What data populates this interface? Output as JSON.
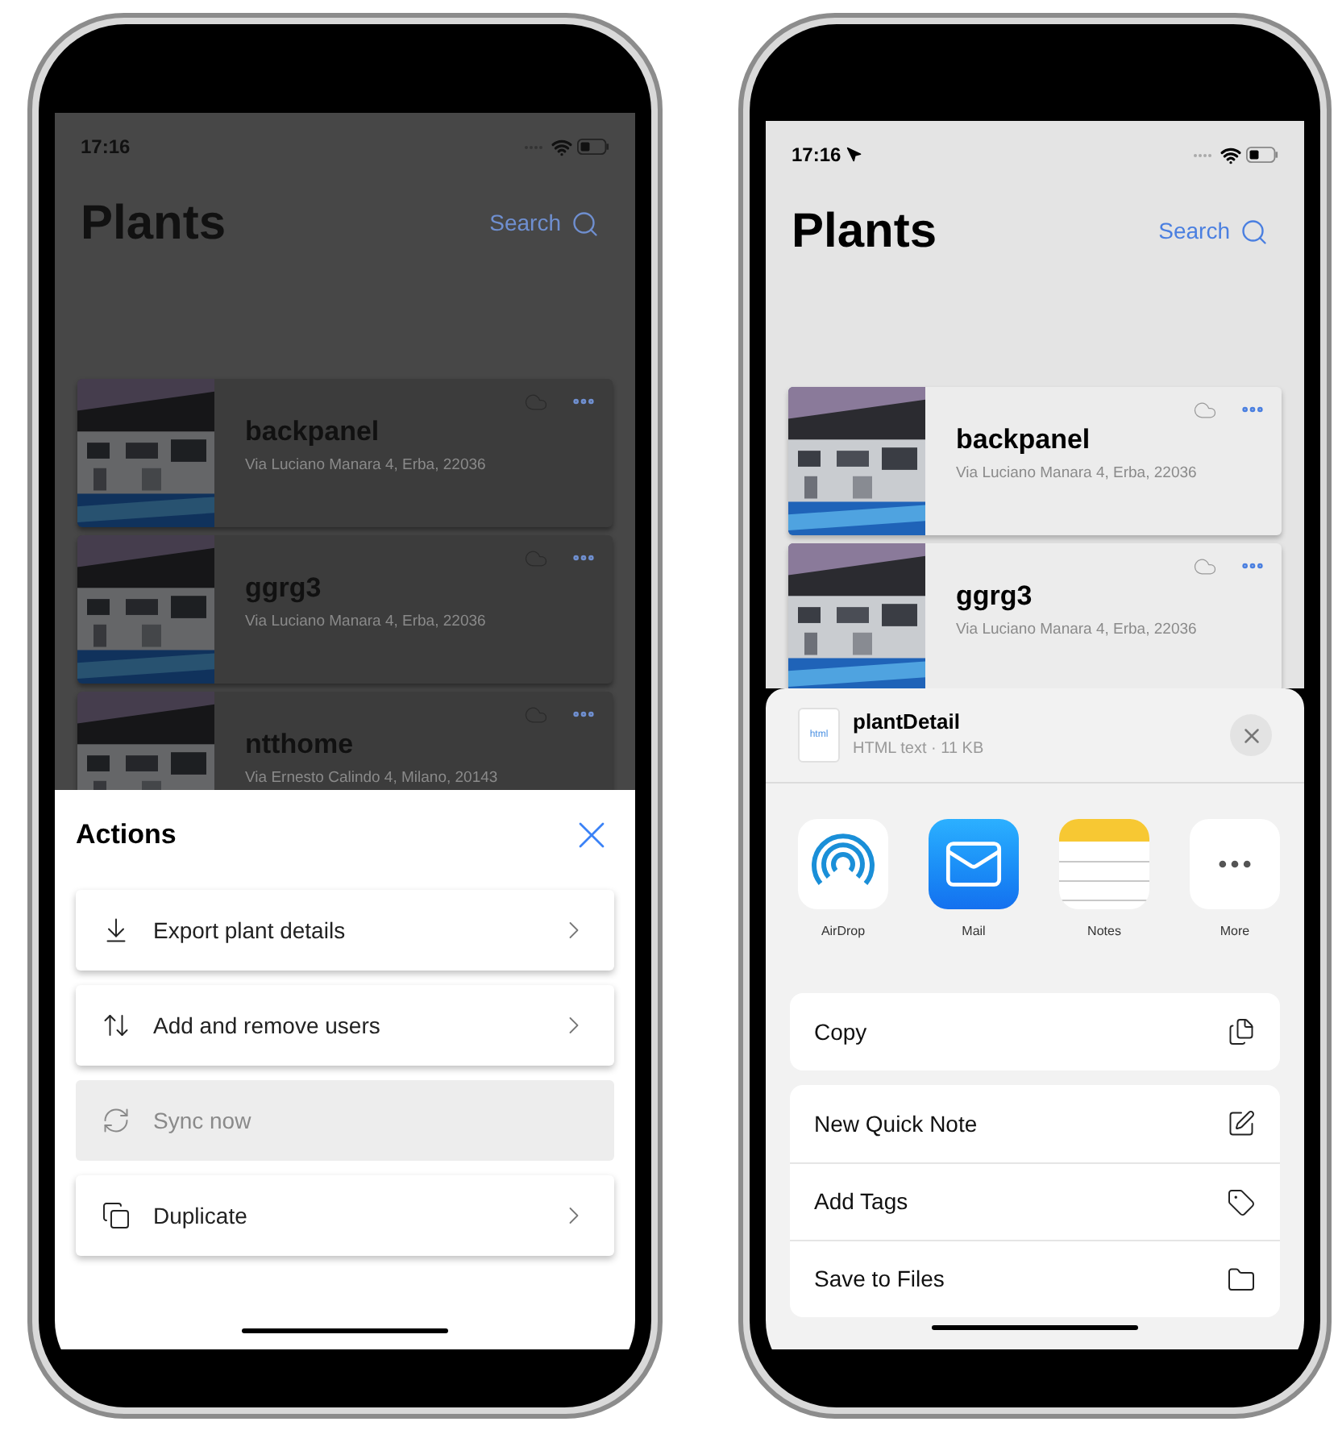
{
  "phones": [
    {
      "dimmed": true,
      "status": {
        "time": "17:16",
        "location": false
      },
      "title": "Plants",
      "search": "Search",
      "plants": [
        {
          "name": "backpanel",
          "address": "Via Luciano Manara 4, Erba, 22036"
        },
        {
          "name": "ggrg3",
          "address": "Via Luciano Manara 4, Erba, 22036"
        },
        {
          "name": "ntthome",
          "address": "Via Ernesto Calindo 4, Milano, 20143"
        }
      ],
      "sheet": {
        "kind": "actions",
        "title": "Actions",
        "items": [
          {
            "label": "Export plant details",
            "kind": "export",
            "disabled": false
          },
          {
            "label": "Add and remove users",
            "kind": "transfer",
            "disabled": false
          },
          {
            "label": "Sync now",
            "kind": "sync",
            "disabled": true
          },
          {
            "label": "Duplicate",
            "kind": "duplicate",
            "disabled": false
          }
        ]
      }
    },
    {
      "dimmed": false,
      "status": {
        "time": "17:16",
        "location": true
      },
      "title": "Plants",
      "search": "Search",
      "plants": [
        {
          "name": "backpanel",
          "address": "Via Luciano Manara 4, Erba, 22036"
        },
        {
          "name": "ggrg3",
          "address": "Via Luciano Manara 4, Erba, 22036"
        }
      ],
      "sheet": {
        "kind": "share",
        "file_badge": "html",
        "file_name": "plantDetail",
        "file_info": "HTML text · 11 KB",
        "apps": [
          {
            "label": "AirDrop",
            "kind": "airdrop"
          },
          {
            "label": "Mail",
            "kind": "mail"
          },
          {
            "label": "Notes",
            "kind": "notes"
          },
          {
            "label": "More",
            "kind": "more"
          }
        ],
        "groups": [
          [
            {
              "label": "Copy",
              "kind": "copy"
            }
          ],
          [
            {
              "label": "New Quick Note",
              "kind": "quick-note"
            },
            {
              "label": "Add Tags",
              "kind": "tag"
            },
            {
              "label": "Save to Files",
              "kind": "folder"
            }
          ]
        ]
      }
    }
  ]
}
